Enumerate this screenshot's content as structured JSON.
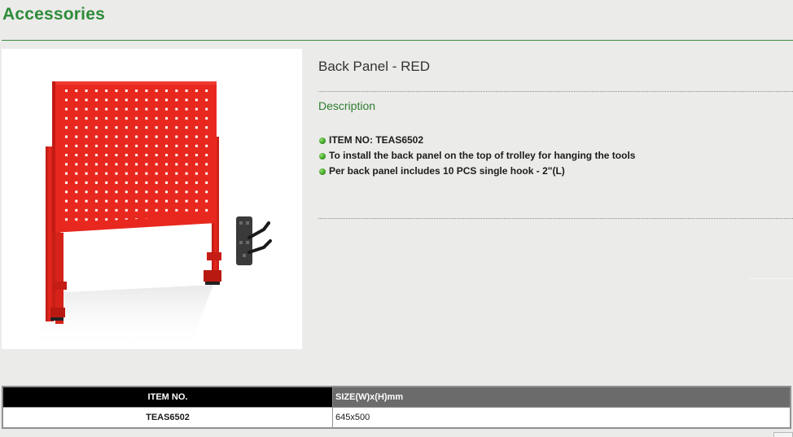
{
  "page": {
    "heading": "Accessories"
  },
  "product": {
    "title": "Back Panel - RED",
    "description_heading": "Description",
    "features": [
      "ITEM NO: TEAS6502",
      "To install the back panel on the top of trolley for hanging the tools",
      "Per back panel includes 10 PCS single hook - 2\"(L)"
    ],
    "image_alt": "Red pegboard back panel with stand legs and a black single hook accessory"
  },
  "spec_table": {
    "headers": [
      "ITEM NO.",
      "SIZE(W)x(H)mm"
    ],
    "rows": [
      [
        "TEAS6502",
        "645x500"
      ]
    ]
  },
  "colors": {
    "brand_green": "#2e8b3a",
    "panel_red": "#e8281f",
    "header_black": "#000000",
    "header_gray": "#6b6b6b",
    "background": "#ebebe9"
  },
  "icons": {
    "bullet": "green-dot-bullet-icon"
  }
}
